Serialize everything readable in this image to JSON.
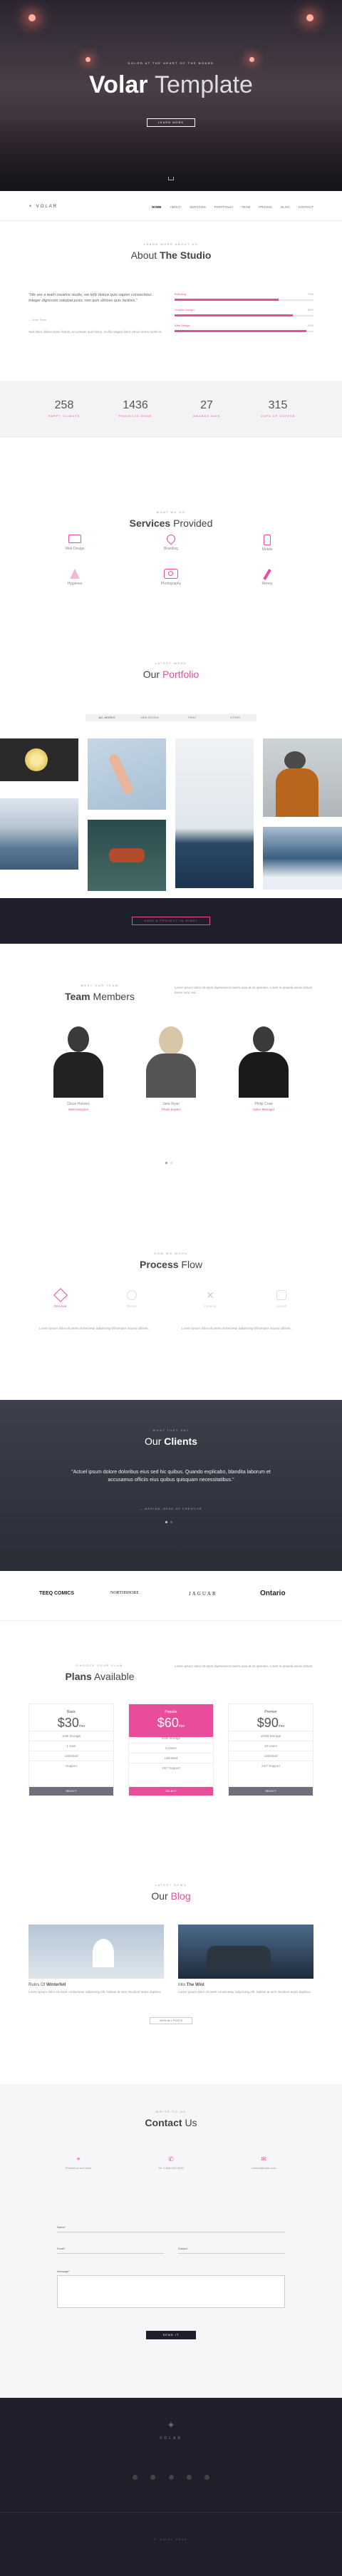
{
  "hero": {
    "kicker": "Dolor at the heart of the board",
    "title_a": "Volar",
    "title_b": "Template",
    "button": "Learn more"
  },
  "nav": {
    "logo": "VOLAR",
    "items": [
      "HOME",
      "ABOUT",
      "SERVICES",
      "PORTFOLIO",
      "TEAM",
      "PRICING",
      "BLOG",
      "CONTACT"
    ]
  },
  "about": {
    "kicker": "Learn more about us",
    "title_a": "About",
    "title_b": "The Studio",
    "quote": "\"We are a team creative studio, we tidly dolore quis sapien consectetur. Integer dignissim volutpat justo, non quis ultrices quis facilisis.\"",
    "author": "— Volar Team",
    "body": "Sed dolor ullamcorper dictum, accumsan quis fusce, mollis magna dolor varius lorem morbi in.",
    "skills": [
      {
        "label": "Branding",
        "pct": "75%",
        "v": 0.75
      },
      {
        "label": "Graphic Design",
        "pct": "85%",
        "v": 0.85
      },
      {
        "label": "Web Design",
        "pct": "95%",
        "v": 0.95
      }
    ]
  },
  "stats": [
    {
      "n": "258",
      "l": "Happy Clients"
    },
    {
      "n": "1436",
      "l": "Projects Done"
    },
    {
      "n": "27",
      "l": "Awards Won"
    },
    {
      "n": "315",
      "l": "Cups of Coffee"
    }
  ],
  "services": {
    "kicker": "What we do",
    "title_a": "Services",
    "title_b": "Provided",
    "items": [
      "Web Design",
      "Branding",
      "Mobile",
      "Hygienes",
      "Photography",
      "Money"
    ]
  },
  "portfolio": {
    "kicker": "Latest work",
    "title_a": "Our",
    "title_b": "Portfolio",
    "filters": [
      "ALL WORKS",
      "WEB DESIGN",
      "PRINT",
      "OTHER"
    ]
  },
  "cta": {
    "button": "Have a project in mind?"
  },
  "team": {
    "kicker": "Meet our team",
    "title_a": "Team",
    "title_b": "Members",
    "intro": "Lorem ipsum dolor sit amet dignissimos marriv quia at sit aperiam, a sem in gravida sociis dictum lorem nunc est.",
    "members": [
      {
        "name": "Oscar Holmes",
        "role": "Web Designer"
      },
      {
        "name": "Jane Ryan",
        "role": "Photo Expert"
      },
      {
        "name": "Philip Craw",
        "role": "Video Manager"
      }
    ]
  },
  "process": {
    "kicker": "How we work",
    "title_a": "Process",
    "title_b": "Flow",
    "steps": [
      "Discover",
      "Design",
      "Develop",
      "Launch"
    ],
    "left": "Lorem ipsum dolor sit amet consectetur adipiscing elit tempor mauris ultrices.",
    "right": "Lorem ipsum dolor sit amet consectetur adipiscing elit tempor mauris ultrices."
  },
  "clients": {
    "kicker": "What they say",
    "title_a": "Our",
    "title_b": "Clients",
    "quote": "\"Actuel ipsum dolore doloribus eius sed hic quibus. Quando explicabo, blandita laborum et accusamus officiis eius quibus quisquam necessitatibus.\"",
    "author": "— MERIAN, HEAD OF CREATIVE",
    "logos": [
      "TEEQ COMICS",
      "NORTHSHORE",
      "JAGUAR",
      "Ontario"
    ]
  },
  "plans": {
    "kicker": "Choose your plan",
    "title_a": "Plans",
    "title_b": "Available",
    "intro": "Lorem ipsum dolor sit amet dignissimos marriv quia at sit aperiam, a sem in gravida sociis dictum.",
    "items": [
      {
        "name": "Basic",
        "price": "$30",
        "per": "/mo",
        "rows": [
          "1GB Storage",
          "1 User",
          "Unlimited",
          "Support"
        ],
        "btn": "SELECT"
      },
      {
        "name": "Popular",
        "price": "$60",
        "per": "/mo",
        "rows": [
          "5GB Storage",
          "5 Users",
          "Unlimited",
          "24/7 Support"
        ],
        "btn": "SELECT"
      },
      {
        "name": "Premier",
        "price": "$90",
        "per": "/mo",
        "rows": [
          "10GB Storage",
          "10 Users",
          "Unlimited",
          "24/7 Support"
        ],
        "btn": "SELECT"
      }
    ]
  },
  "blog": {
    "kicker": "Latest news",
    "title_a": "Our",
    "title_b": "Blog",
    "posts": [
      {
        "title_a": "Ruins Of",
        "title_b": "Winterfell",
        "text": "Lorem ipsum dolor sit amet consectetur adipiscing elit. Nullam at sem tincidunt turpis dapibus."
      },
      {
        "title_a": "Into",
        "title_b": "The Wild",
        "text": "Lorem ipsum dolor sit amet consectetur adipiscing elit. Nullam at sem tincidunt turpis dapibus."
      }
    ],
    "button": "View all posts"
  },
  "contact": {
    "kicker": "Write to us",
    "title_a": "Contact",
    "title_b": "Us",
    "info": [
      "Photoshop and tools",
      "Tel: 1-800-000-0000",
      "contact@volar.com"
    ],
    "fields": {
      "name": "Name*",
      "email": "Email*",
      "subject": "Subject",
      "message": "Message*"
    },
    "button": "Send it"
  },
  "footer": {
    "logo": "VOLAR",
    "copy": "© Volar 2015"
  },
  "colors": {
    "accent": "#e84c9a",
    "dark": "#1e1f2b"
  }
}
